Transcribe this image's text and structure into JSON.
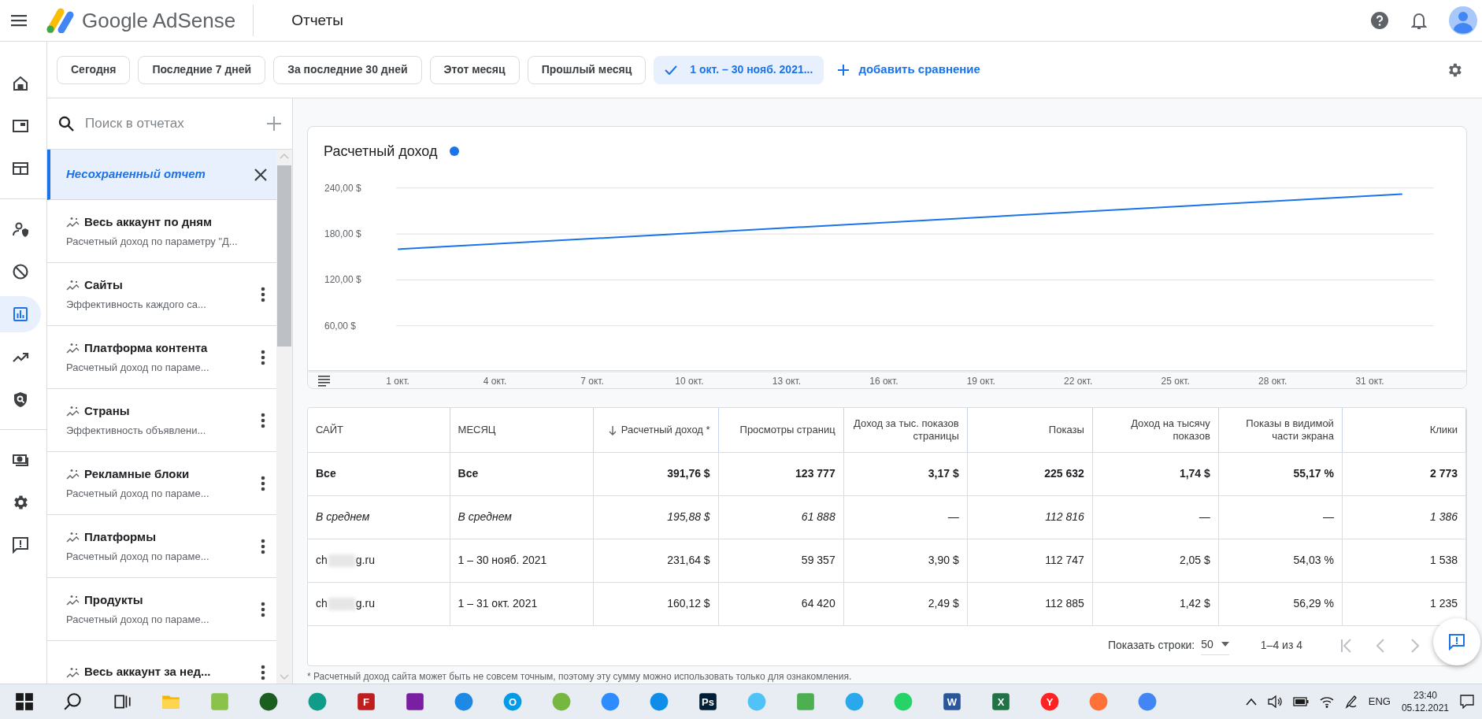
{
  "header": {
    "product": "Google AdSense",
    "page_title": "Отчеты"
  },
  "nav_rail": [
    [
      {
        "selected": false
      },
      {
        "selected": false
      },
      {
        "selected": false
      }
    ],
    [
      {
        "selected": false
      },
      {
        "selected": false
      },
      {
        "selected": true
      },
      {
        "selected": false
      },
      {
        "selected": false
      }
    ],
    [
      {
        "selected": false
      },
      {
        "selected": false
      },
      {
        "selected": false
      }
    ]
  ],
  "date_filters": [
    {
      "label": "Сегодня",
      "selected": false
    },
    {
      "label": "Последние 7 дней",
      "selected": false
    },
    {
      "label": "За последние 30 дней",
      "selected": false
    },
    {
      "label": "Этот месяц",
      "selected": false
    },
    {
      "label": "Прошлый месяц",
      "selected": false
    },
    {
      "label": "1 окт. – 30 нояб. 2021...",
      "selected": true
    }
  ],
  "compare_link": "добавить сравнение",
  "report_search": {
    "placeholder": "Поиск в отчетах"
  },
  "unsaved_report": {
    "label": "Несохраненный отчет",
    "selected": true
  },
  "saved_reports": [
    {
      "title": "Весь аккаунт по дням",
      "subtitle": "Расчетный доход по параметру \"Д...",
      "menu": false
    },
    {
      "title": "Сайты",
      "subtitle": "Эффективность каждого са...",
      "menu": true
    },
    {
      "title": "Платформа контента",
      "subtitle": "Расчетный доход по параме...",
      "menu": true
    },
    {
      "title": "Страны",
      "subtitle": "Эффективность объявлени...",
      "menu": true
    },
    {
      "title": "Рекламные блоки",
      "subtitle": "Расчетный доход по параме...",
      "menu": true
    },
    {
      "title": "Платформы",
      "subtitle": "Расчетный доход по параме...",
      "menu": true
    },
    {
      "title": "Продукты",
      "subtitle": "Расчетный доход по параме...",
      "menu": true
    },
    {
      "title": "Весь аккаунт за нед...",
      "menu": true
    }
  ],
  "chart": {
    "title": "Расчетный доход",
    "chart_data": {
      "type": "line",
      "x": [
        1,
        32
      ],
      "xlim": [
        -1.75,
        34
      ],
      "ylim": [
        0,
        320
      ],
      "grid": true,
      "xticks": [
        {
          "value": 1,
          "label": "1 окт."
        },
        {
          "value": 4,
          "label": "4 окт."
        },
        {
          "value": 7,
          "label": "7 окт."
        },
        {
          "value": 10,
          "label": "10 окт."
        },
        {
          "value": 13,
          "label": "13 окт."
        },
        {
          "value": 16,
          "label": "16 окт."
        },
        {
          "value": 19,
          "label": "19 окт."
        },
        {
          "value": 22,
          "label": "22 окт."
        },
        {
          "value": 25,
          "label": "25 окт."
        },
        {
          "value": 28,
          "label": "28 окт."
        },
        {
          "value": 31,
          "label": "31 окт."
        }
      ],
      "yticks": [
        {
          "value": 60,
          "label": "60,00 $"
        },
        {
          "value": 120,
          "label": "120,00 $"
        },
        {
          "value": 180,
          "label": "180,00 $"
        },
        {
          "value": 240,
          "label": "240,00 $"
        }
      ],
      "series": [
        {
          "color": "#1a73e8",
          "values": [
            160,
            232
          ]
        }
      ]
    }
  },
  "table": {
    "columns": [
      {
        "label": "САЙТ",
        "sorted": false
      },
      {
        "label": "МЕСЯЦ",
        "sorted": false
      },
      {
        "label": "Расчетный доход *",
        "sorted": true
      },
      {
        "label": "Просмотры страниц",
        "sorted": false
      },
      {
        "label": "Доход за тыс. показов страницы",
        "sorted": false
      },
      {
        "label": "Показы",
        "sorted": false
      },
      {
        "label": "Доход на тысячу показов",
        "sorted": false
      },
      {
        "label": "Показы в видимой части экрана",
        "sorted": false
      },
      {
        "label": "Клики",
        "sorted": false
      }
    ],
    "rows": [
      {
        "kind": "total",
        "cells": [
          "Все",
          "Все",
          "391,76 $",
          "123 777",
          "3,17 $",
          "225 632",
          "1,74 $",
          "55,17 %",
          "2 773"
        ]
      },
      {
        "kind": "average",
        "cells": [
          "В среднем",
          "В среднем",
          "195,88 $",
          "61 888",
          "—",
          "112 816",
          "—",
          "—",
          "1 386"
        ]
      },
      {
        "kind": "site",
        "site_start": "ch",
        "site_end": "g.ru",
        "cells": [
          "1 – 30 нояб. 2021",
          "231,64 $",
          "59 357",
          "3,90 $",
          "112 747",
          "2,05 $",
          "54,03 %",
          "1 538"
        ]
      },
      {
        "kind": "site",
        "site_start": "ch",
        "site_end": "g.ru",
        "cells": [
          "1 – 31 окт. 2021",
          "160,12 $",
          "64 420",
          "2,49 $",
          "112 885",
          "1,42 $",
          "56,29 %",
          "1 235"
        ]
      }
    ]
  },
  "pagination": {
    "rows_label": "Показать строки:",
    "rows_value": "50",
    "range": "1–4 из 4"
  },
  "footnote": "* Расчетный доход сайта может быть не совсем точным, поэтому эту сумму можно использовать только для ознакомления.",
  "taskbar": {
    "apps": [
      {
        "kind": "start"
      },
      {
        "kind": "search"
      },
      {
        "kind": "taskview"
      },
      {
        "kind": "folder"
      },
      {
        "kind": "tile",
        "color": "#8bc34a"
      },
      {
        "kind": "circle",
        "color": "#1b5e20"
      },
      {
        "kind": "circle",
        "color": "#0f9d8a"
      },
      {
        "kind": "tile",
        "color": "#bf1e1e",
        "glyph": "F"
      },
      {
        "kind": "tile",
        "color": "#7b1fa2"
      },
      {
        "kind": "circle",
        "color": "#1e88e5"
      },
      {
        "kind": "circle",
        "color": "#039be5",
        "glyph": "O"
      },
      {
        "kind": "circle",
        "color": "#76b83f"
      },
      {
        "kind": "circle",
        "color": "#2d8cff"
      },
      {
        "kind": "circle",
        "color": "#0e8ee9"
      },
      {
        "kind": "tile",
        "color": "#001e36",
        "glyph": "Ps"
      },
      {
        "kind": "circle",
        "color": "#4fc3f7"
      },
      {
        "kind": "tile",
        "color": "#4caf50"
      },
      {
        "kind": "circle",
        "color": "#29a9eb"
      },
      {
        "kind": "circle",
        "color": "#25d366"
      },
      {
        "kind": "tile",
        "color": "#2b579a",
        "glyph": "W"
      },
      {
        "kind": "tile",
        "color": "#217346",
        "glyph": "X"
      },
      {
        "kind": "circle",
        "color": "#ff2222",
        "glyph": "Y"
      },
      {
        "kind": "circle",
        "color": "#ff7139"
      },
      {
        "kind": "circle",
        "color": "#4285f4"
      }
    ],
    "language": "ENG",
    "time": "23:40",
    "date": "05.12.2021"
  }
}
